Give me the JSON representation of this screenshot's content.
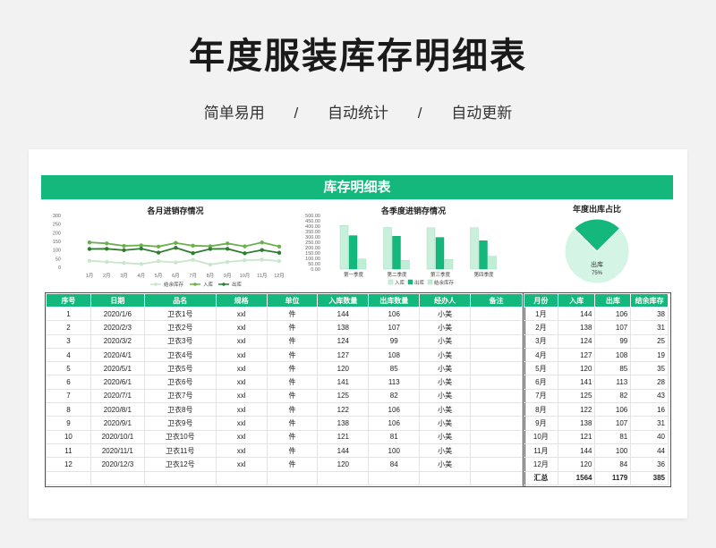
{
  "page": {
    "title": "年度服装库存明细表",
    "subtitle": [
      "简单易用",
      "/",
      "自动统计",
      "/",
      "自动更新"
    ]
  },
  "sheet": {
    "banner": "库存明细表",
    "colors": {
      "accent": "#14b87c",
      "dark_green": "#2e7d32",
      "mid_green": "#6ab04c",
      "light_green": "#c8e6c9"
    }
  },
  "chart_data": [
    {
      "type": "line",
      "title": "各月进销存情况",
      "categories": [
        "1月",
        "2月",
        "3月",
        "4月",
        "5月",
        "6月",
        "7月",
        "8月",
        "9月",
        "10月",
        "11月",
        "12月"
      ],
      "series": [
        {
          "name": "结余库存",
          "values": [
            38,
            31,
            25,
            19,
            35,
            28,
            43,
            16,
            31,
            40,
            44,
            36
          ]
        },
        {
          "name": "入库",
          "values": [
            144,
            138,
            124,
            127,
            120,
            141,
            125,
            122,
            138,
            121,
            144,
            120
          ]
        },
        {
          "name": "出库",
          "values": [
            106,
            107,
            99,
            108,
            85,
            113,
            82,
            106,
            107,
            81,
            100,
            84
          ]
        }
      ],
      "yticks": [
        0,
        50,
        100,
        150,
        200,
        250,
        300
      ],
      "ylim": [
        0,
        300
      ]
    },
    {
      "type": "bar",
      "title": "各季度进销存情况",
      "categories": [
        "第一季度",
        "第二季度",
        "第三季度",
        "第四季度"
      ],
      "series": [
        {
          "name": "入库",
          "values": [
            406,
            388,
            385,
            385
          ]
        },
        {
          "name": "出库",
          "values": [
            312,
            306,
            295,
            265
          ]
        },
        {
          "name": "结余库存",
          "values": [
            94,
            82,
            90,
            120
          ]
        }
      ],
      "yticks": [
        "0.00",
        "50.00",
        "100.00",
        "150.00",
        "200.00",
        "250.00",
        "300.00",
        "350.00",
        "400.00",
        "450.00",
        "500.00"
      ],
      "ylim": [
        0,
        500
      ]
    },
    {
      "type": "pie",
      "title": "年度出库占比",
      "slices": [
        {
          "name": "出库",
          "label": "出库",
          "pct_label": "75%",
          "value": 75
        },
        {
          "name": "",
          "value": 25
        }
      ]
    }
  ],
  "table": {
    "headers": [
      "序号",
      "日期",
      "品名",
      "规格",
      "单位",
      "入库数量",
      "出库数量",
      "经办人",
      "备注"
    ],
    "rows": [
      [
        "1",
        "2020/1/6",
        "卫衣1号",
        "xxl",
        "件",
        "144",
        "106",
        "小美",
        ""
      ],
      [
        "2",
        "2020/2/3",
        "卫衣2号",
        "xxl",
        "件",
        "138",
        "107",
        "小美",
        ""
      ],
      [
        "3",
        "2020/3/2",
        "卫衣3号",
        "xxl",
        "件",
        "124",
        "99",
        "小美",
        ""
      ],
      [
        "4",
        "2020/4/1",
        "卫衣4号",
        "xxl",
        "件",
        "127",
        "108",
        "小美",
        ""
      ],
      [
        "5",
        "2020/5/1",
        "卫衣5号",
        "xxl",
        "件",
        "120",
        "85",
        "小美",
        ""
      ],
      [
        "6",
        "2020/6/1",
        "卫衣6号",
        "xxl",
        "件",
        "141",
        "113",
        "小美",
        ""
      ],
      [
        "7",
        "2020/7/1",
        "卫衣7号",
        "xxl",
        "件",
        "125",
        "82",
        "小美",
        ""
      ],
      [
        "8",
        "2020/8/1",
        "卫衣8号",
        "xxl",
        "件",
        "122",
        "106",
        "小美",
        ""
      ],
      [
        "9",
        "2020/9/1",
        "卫衣9号",
        "xxl",
        "件",
        "138",
        "106",
        "小美",
        ""
      ],
      [
        "10",
        "2020/10/1",
        "卫衣10号",
        "xxl",
        "件",
        "121",
        "81",
        "小美",
        ""
      ],
      [
        "11",
        "2020/11/1",
        "卫衣11号",
        "xxl",
        "件",
        "144",
        "100",
        "小美",
        ""
      ],
      [
        "12",
        "2020/12/3",
        "卫衣12号",
        "xxl",
        "件",
        "120",
        "84",
        "小美",
        ""
      ]
    ]
  },
  "summary": {
    "headers": [
      "月份",
      "入库",
      "出库",
      "结余库存"
    ],
    "rows": [
      [
        "1月",
        "144",
        "106",
        "38"
      ],
      [
        "2月",
        "138",
        "107",
        "31"
      ],
      [
        "3月",
        "124",
        "99",
        "25"
      ],
      [
        "4月",
        "127",
        "108",
        "19"
      ],
      [
        "5月",
        "120",
        "85",
        "35"
      ],
      [
        "6月",
        "141",
        "113",
        "28"
      ],
      [
        "7月",
        "125",
        "82",
        "43"
      ],
      [
        "8月",
        "122",
        "106",
        "16"
      ],
      [
        "9月",
        "138",
        "107",
        "31"
      ],
      [
        "10月",
        "121",
        "81",
        "40"
      ],
      [
        "11月",
        "144",
        "100",
        "44"
      ],
      [
        "12月",
        "120",
        "84",
        "36"
      ]
    ],
    "total": [
      "汇总",
      "1564",
      "1179",
      "385"
    ]
  }
}
